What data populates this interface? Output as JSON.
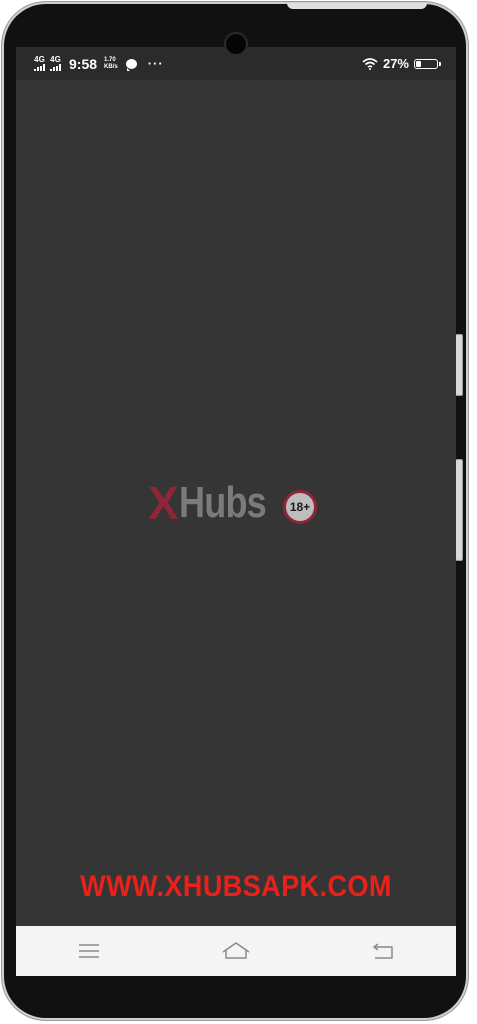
{
  "status_bar": {
    "network_1": "4G",
    "network_2": "4G",
    "time": "9:58",
    "speed_value": "1.70",
    "speed_unit": "KB/s",
    "more": "···",
    "battery_percent": "27%",
    "battery_level": 0.27
  },
  "splash": {
    "logo_x": "X",
    "logo_rest": "Hubs",
    "age_badge": "18+",
    "logo_colors": {
      "x": "#8e2538",
      "rest": "#7b7b7b"
    }
  },
  "watermark": {
    "text": "WWW.XHUBSAPK.COM",
    "color": "#e8221b"
  },
  "nav_bar": {
    "menu_icon": "menu-icon",
    "home_icon": "home-icon",
    "back_icon": "back-icon"
  },
  "colors": {
    "screen_bg": "#353535",
    "status_bg": "#2b2b2b",
    "nav_bg": "#f4f4f4"
  }
}
